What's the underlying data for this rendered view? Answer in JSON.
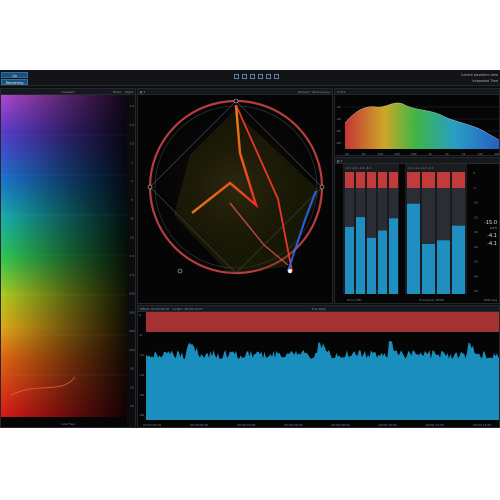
{
  "toolbar": {
    "button_1": "Go",
    "button_2": "Rendering",
    "right_line_1": "Current waveform view",
    "right_line_2": "Integrated  Time"
  },
  "spectrogram_panel": {
    "header_center": "Gradient",
    "header_right_label": "Mode",
    "header_right": "Right",
    "footer": "Low Freq",
    "right_scale": [
      "0.1",
      "0.2",
      "0.5",
      "1",
      "2",
      "5",
      "10",
      "20",
      "1.5",
      "2.5",
      "500",
      "300",
      "200",
      "100",
      "50",
      "50",
      "25"
    ]
  },
  "vectorscope_panel": {
    "header_right": "Default / Vectorscope"
  },
  "spectrum_panel": {
    "header_tools": "A  M  S",
    "freq_ticks": [
      "20",
      "50",
      "100",
      "200",
      "500",
      "1k",
      "2k",
      "5k",
      "10k",
      "20k"
    ],
    "level_ticks": [
      "-20",
      "-40",
      "-60",
      "-80"
    ]
  },
  "meters_panel": {
    "group_1_values": [
      "-4.4",
      "-6.0",
      "-4.4",
      "-4.0"
    ],
    "group_2_values": [
      "-4.0",
      "-4.2",
      "-4.3",
      "-4.2"
    ],
    "group_1_label": "Error (dB)",
    "group_2_label": "True Peak (dBTP)",
    "group_1_levels": [
      0.55,
      0.63,
      0.46,
      0.52,
      0.62
    ],
    "group_2_levels": [
      0.74,
      0.41,
      0.44,
      0.56
    ],
    "readout_1": "-15.0",
    "readout_2": "-4.1",
    "readout_3": "-4.1",
    "readout_unit": "LUFS",
    "scale": [
      "0",
      "-5",
      "-10",
      "-15",
      "-20",
      "-25",
      "-30",
      "-40",
      "-50"
    ],
    "footer": "RMS Avg"
  },
  "history_panel": {
    "header_left": "Offset: 00:00:00:00 · Length: 00:00:14:27",
    "header_center": "True Peak",
    "timecodes": [
      "00:00:00:00",
      "00:00:02:00",
      "00:00:04:00",
      "00:00:06:00",
      "00:00:08:00",
      "00:00:10:00",
      "00:00:12:00",
      "00:00:14:00"
    ],
    "scale": [
      "0",
      "-6",
      "-12",
      "-24",
      "-36",
      "-48"
    ]
  },
  "colors": {
    "meter_blue": "#1e8fc0",
    "peak_red": "#c23b3b",
    "history_blue": "#1b97c8",
    "accent_button": "#1b4f7a"
  }
}
